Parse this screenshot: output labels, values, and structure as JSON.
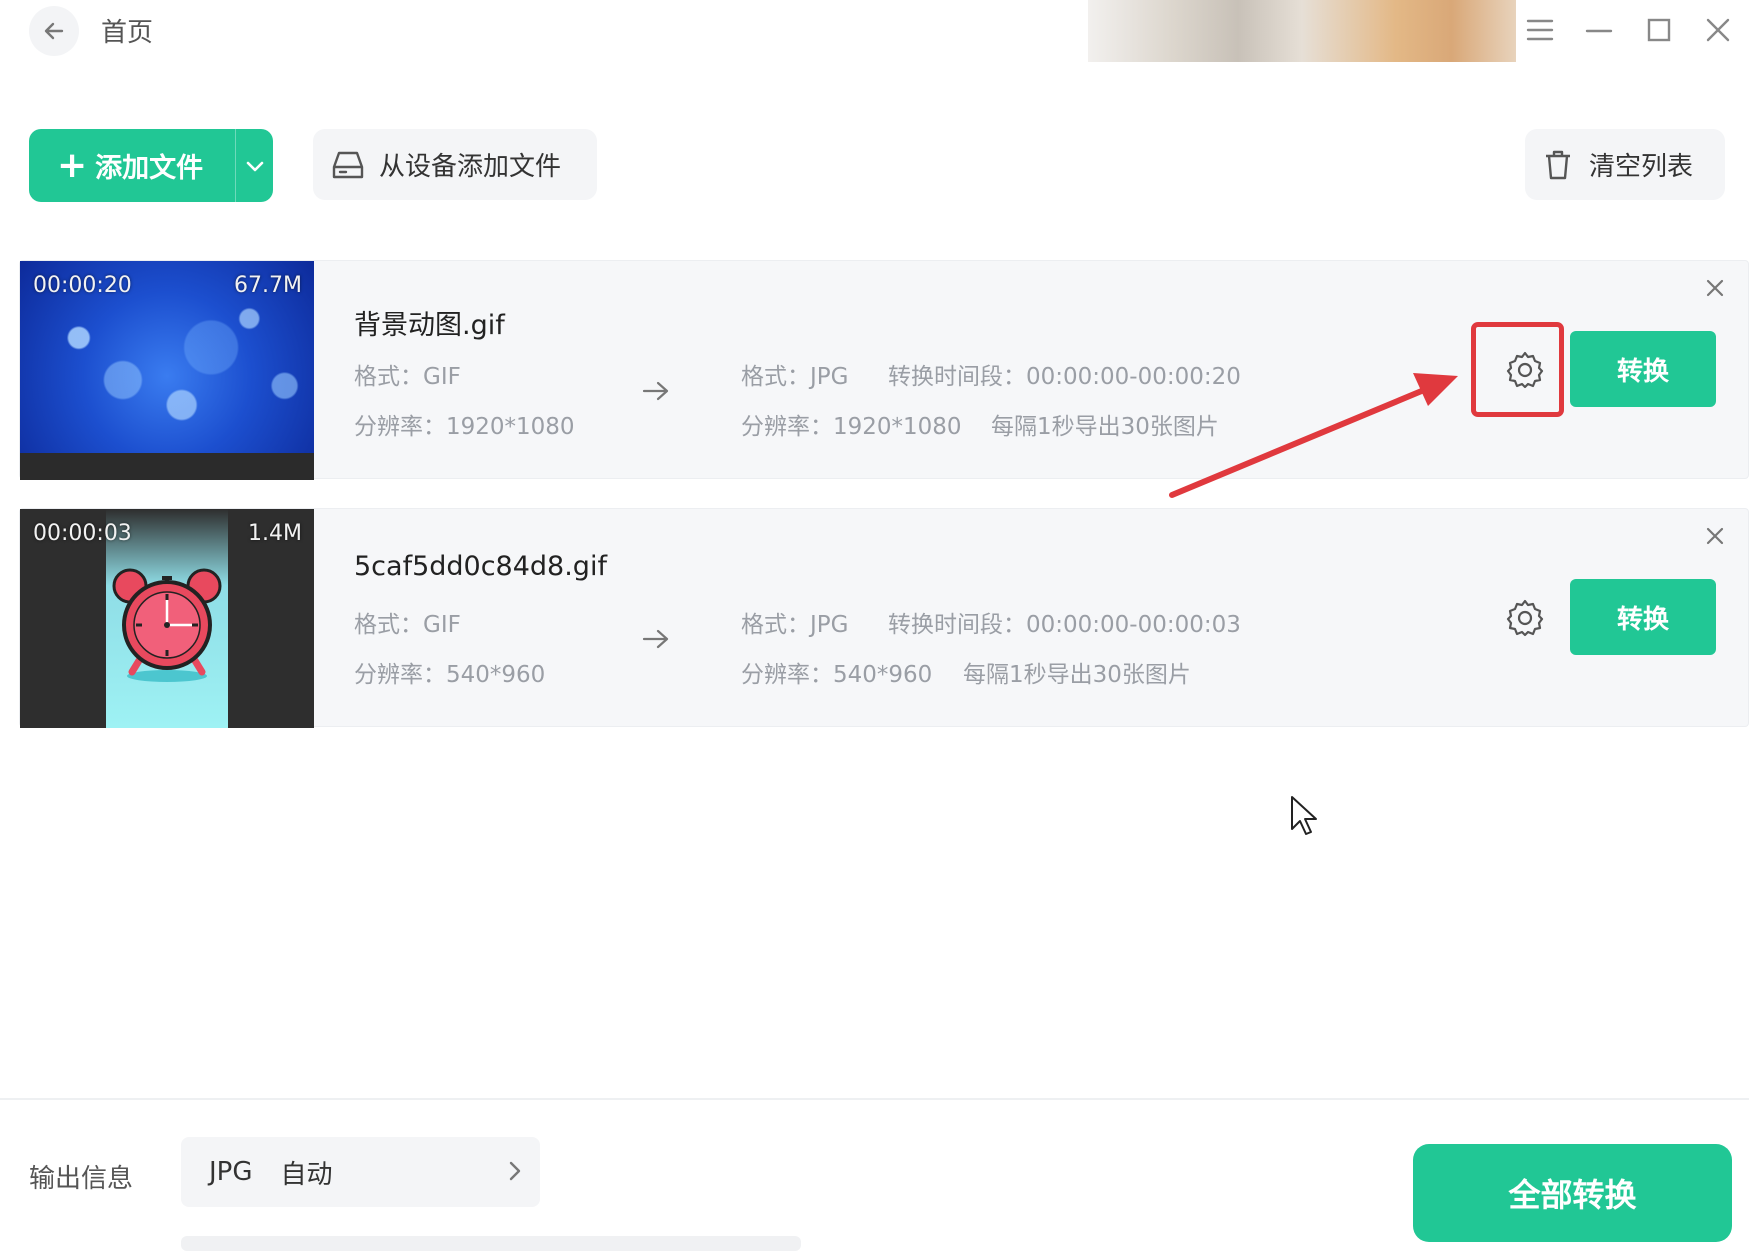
{
  "header": {
    "title": "首页"
  },
  "toolbar": {
    "add_files_label": "添加文件",
    "add_from_device_label": "从设备添加文件",
    "clear_list_label": "清空列表"
  },
  "files": [
    {
      "thumb_time": "00:00:20",
      "thumb_size": "67.7M",
      "name": "背景动图.gif",
      "src_format": "格式：GIF",
      "src_resolution": "分辨率：1920*1080",
      "dst_format": "格式：JPG",
      "time_range": "转换时间段：00:00:00-00:00:20",
      "dst_resolution": "分辨率：1920*1080",
      "export_rate": "每隔1秒导出30张图片",
      "convert_label": "转换"
    },
    {
      "thumb_time": "00:00:03",
      "thumb_size": "1.4M",
      "name": "5caf5dd0c84d8.gif",
      "src_format": "格式：GIF",
      "src_resolution": "分辨率：540*960",
      "dst_format": "格式：JPG",
      "time_range": "转换时间段：00:00:00-00:00:03",
      "dst_resolution": "分辨率：540*960",
      "export_rate": "每隔1秒导出30张图片",
      "convert_label": "转换"
    }
  ],
  "footer": {
    "output_label": "输出信息",
    "output_format": "JPG",
    "output_mode": "自动",
    "convert_all_label": "全部转换"
  },
  "colors": {
    "accent": "#21c795",
    "annotation": "#e0393e"
  }
}
